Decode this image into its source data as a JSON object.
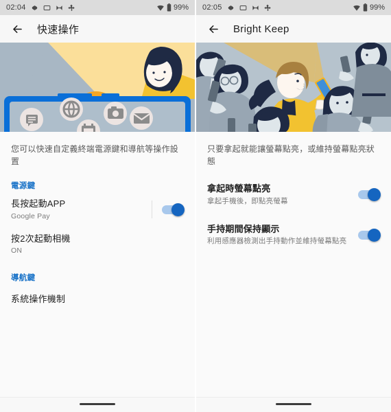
{
  "left": {
    "status": {
      "time": "02:04",
      "icons": [
        "gear-icon",
        "screenshot-icon",
        "bowtie-icon",
        "move-icon"
      ],
      "wifi": "wifi-icon",
      "battery": "battery-icon",
      "battery_text": "99%"
    },
    "appbar": {
      "back": "back-arrow-icon",
      "title": "快速操作"
    },
    "hero": {
      "name": "quick-action-illustration",
      "colors": {
        "sky": "#a8b7c4",
        "beam": "#fbdf9a",
        "device": "#0a6fd8",
        "coin": "#f5a623",
        "money": "#1aa8a0"
      }
    },
    "intro": "您可以快速自定義終端電源鍵和導航等操作設置",
    "sections": [
      {
        "header": "電源鍵",
        "rows": [
          {
            "title": "長按起動APP",
            "sub": "Google Pay",
            "toggle": true,
            "divider": true
          },
          {
            "title": "按2次起動相機",
            "sub": "ON",
            "toggle": false,
            "divider": false
          }
        ]
      },
      {
        "header": "導航鍵",
        "rows": [
          {
            "title": "系統操作機制",
            "sub": "",
            "toggle": false,
            "divider": false
          }
        ]
      }
    ]
  },
  "right": {
    "status": {
      "time": "02:05",
      "icons": [
        "gear-icon",
        "screenshot-icon",
        "bowtie-icon",
        "move-icon"
      ],
      "wifi": "wifi-icon",
      "battery": "battery-icon",
      "battery_text": "99%"
    },
    "appbar": {
      "back": "back-arrow-icon",
      "title": "Bright Keep"
    },
    "hero": {
      "name": "crowd-phone-illustration",
      "colors": {
        "sky": "#b6c3cd",
        "beam": "#d9bd79",
        "highlight": "#f2c230",
        "dark": "#1f2a44"
      }
    },
    "intro": "只要拿起就能讓螢幕點亮，或維持螢幕點亮狀態",
    "sections": [
      {
        "header": "",
        "rows": [
          {
            "title": "拿起時螢幕點亮",
            "sub": "拿起手機後，即點亮螢幕",
            "toggle": true,
            "divider": false
          },
          {
            "title": "手持期間保持顯示",
            "sub": "利用感應器檢測出手持動作並維持螢幕點亮",
            "toggle": true,
            "divider": false
          }
        ]
      }
    ]
  },
  "navbar": {
    "pill": "gesture-nav-pill"
  }
}
